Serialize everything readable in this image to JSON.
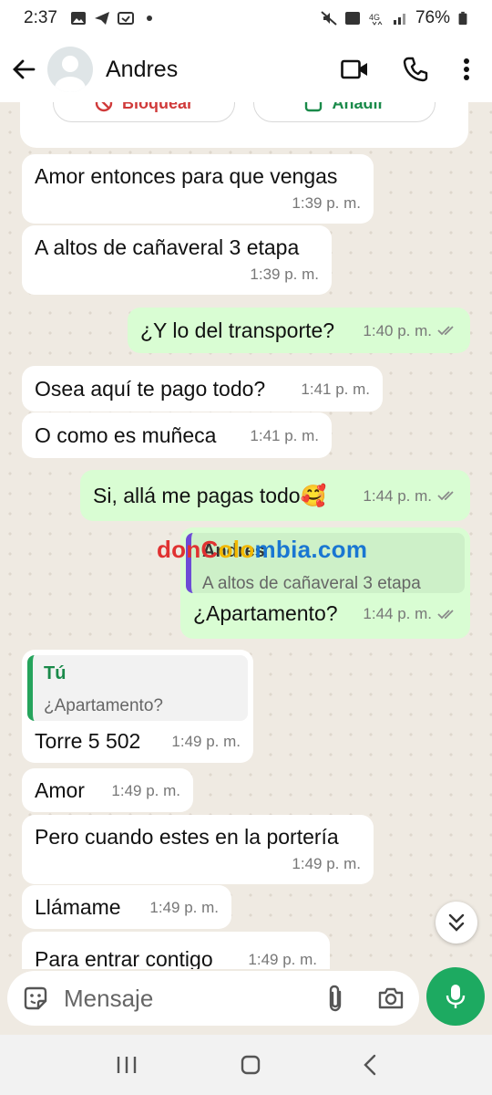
{
  "status_bar": {
    "time": "2:37",
    "battery": "76%"
  },
  "header": {
    "contact_name": "Andres"
  },
  "top_card": {
    "block_label": "Bloquear",
    "add_label": "Añadir"
  },
  "messages": [
    {
      "dir": "in",
      "text": "Amor entonces para que vengas",
      "time": "1:39 p. m."
    },
    {
      "dir": "in",
      "text": "A altos de cañaveral 3 etapa",
      "time": "1:39 p. m."
    },
    {
      "dir": "out",
      "text": "¿Y lo del transporte?",
      "time": "1:40 p. m."
    },
    {
      "dir": "in",
      "text": "Osea aquí te pago todo?",
      "time": "1:41 p. m."
    },
    {
      "dir": "in",
      "text": "O como es muñeca",
      "time": "1:41 p. m."
    },
    {
      "dir": "out",
      "text": "Si, allá me pagas todo🥰",
      "time": "1:44 p. m."
    },
    {
      "dir": "out",
      "quote_name": "Andres",
      "quote_text": "A altos de cañaveral 3 etapa",
      "text": "¿Apartamento?",
      "time": "1:44 p. m."
    },
    {
      "dir": "in",
      "quote_name": "Tú",
      "quote_text": "¿Apartamento?",
      "text": "Torre 5 502",
      "time": "1:49 p. m."
    },
    {
      "dir": "in",
      "text": "Amor",
      "time": "1:49 p. m."
    },
    {
      "dir": "in",
      "text": "Pero cuando estes en la portería",
      "time": "1:49 p. m."
    },
    {
      "dir": "in",
      "text": "Llámame",
      "time": "1:49 p. m."
    },
    {
      "dir": "in",
      "text": "Para entrar contigo",
      "time": "1:49 p. m."
    }
  ],
  "watermark": {
    "part1": "donC",
    "part2": "olo",
    "part3": "mbia.com"
  },
  "input": {
    "placeholder": "Mensaje"
  },
  "colors": {
    "outgoing_bubble": "#d9fdd3",
    "incoming_bubble": "#ffffff",
    "accent": "#1daa61",
    "chat_bg": "#efeae2"
  }
}
